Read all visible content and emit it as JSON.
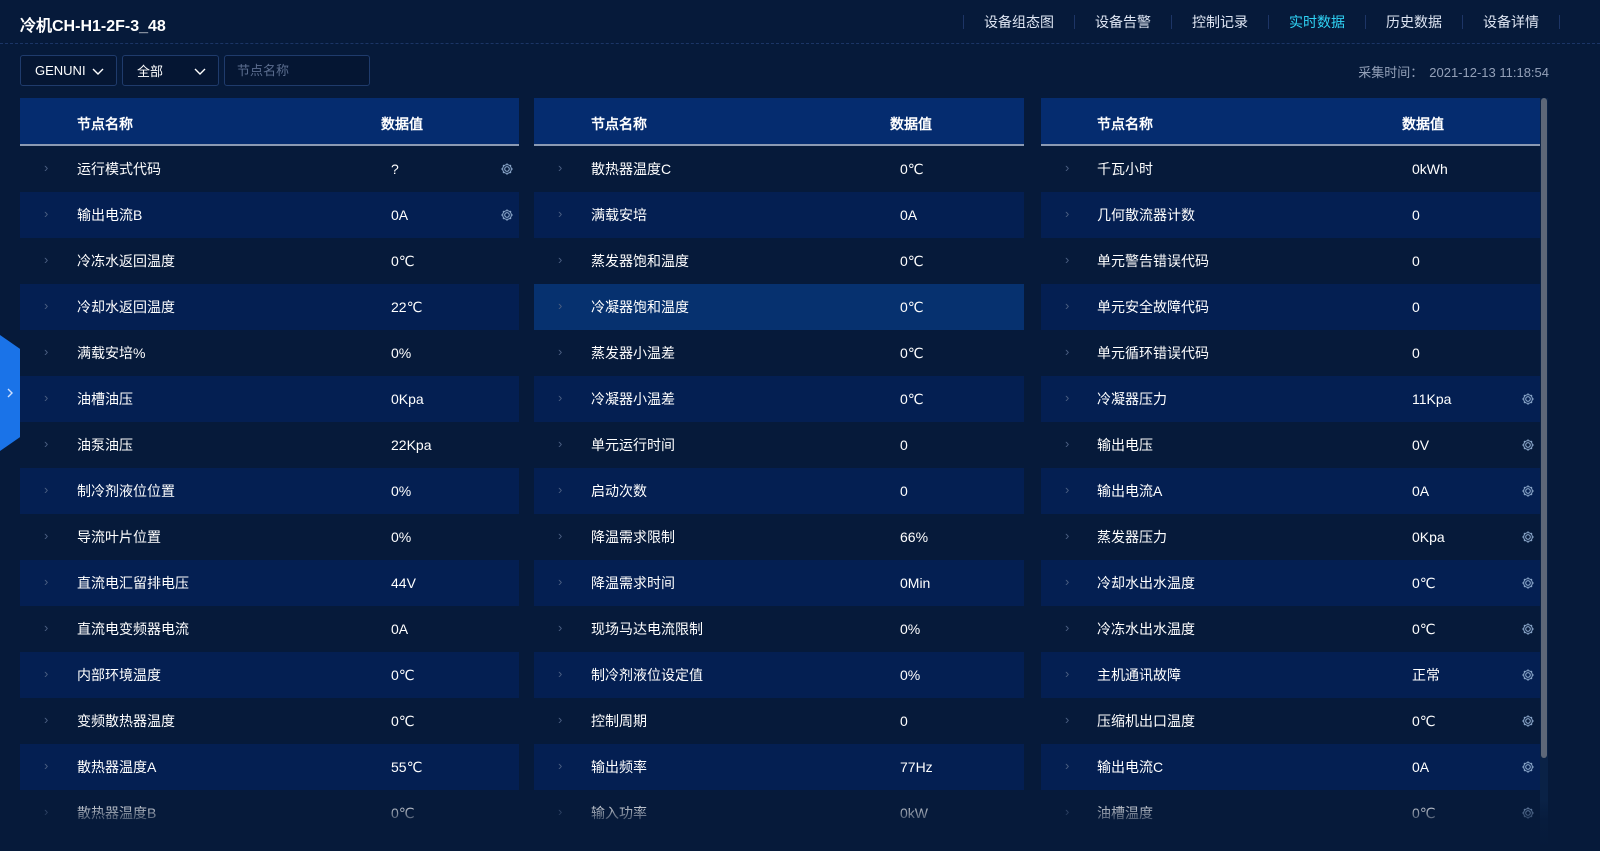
{
  "header": {
    "title": "冷机CH-H1-2F-3_48",
    "nav": [
      "设备组态图",
      "设备告警",
      "控制记录",
      "实时数据",
      "历史数据",
      "设备详情"
    ],
    "active_nav": "实时数据"
  },
  "filters": {
    "select1": "GENUNI",
    "select2": "全部",
    "search_placeholder": "节点名称"
  },
  "collect": {
    "label": "采集时间：",
    "value": "2021-12-13 11:18:54"
  },
  "colors": {
    "accent": "#2fd3f5",
    "background": "#061a3a",
    "header": "#052c6f",
    "side_tab": "#1a73e8"
  },
  "panels": [
    {
      "headers": [
        "节点名称",
        "数据值"
      ],
      "rows": [
        {
          "name": "运行模式代码",
          "value": "?",
          "gear": true
        },
        {
          "name": "输出电流B",
          "value": "0A",
          "gear": true
        },
        {
          "name": "冷冻水返回温度",
          "value": "0℃",
          "gear": false
        },
        {
          "name": "冷却水返回温度",
          "value": "22℃",
          "gear": false
        },
        {
          "name": "满载安培%",
          "value": "0%",
          "gear": false
        },
        {
          "name": "油槽油压",
          "value": "0Kpa",
          "gear": false
        },
        {
          "name": "油泵油压",
          "value": "22Kpa",
          "gear": false
        },
        {
          "name": "制冷剂液位位置",
          "value": "0%",
          "gear": false
        },
        {
          "name": "导流叶片位置",
          "value": "0%",
          "gear": false
        },
        {
          "name": "直流电汇留排电压",
          "value": "44V",
          "gear": false
        },
        {
          "name": "直流电变频器电流",
          "value": "0A",
          "gear": false
        },
        {
          "name": "内部环境温度",
          "value": "0℃",
          "gear": false
        },
        {
          "name": "变频散热器温度",
          "value": "0℃",
          "gear": false
        },
        {
          "name": "散热器温度A",
          "value": "55℃",
          "gear": false
        },
        {
          "name": "散热器温度B",
          "value": "0℃",
          "gear": false
        }
      ]
    },
    {
      "headers": [
        "节点名称",
        "数据值"
      ],
      "rows": [
        {
          "name": "散热器温度C",
          "value": "0℃",
          "gear": false
        },
        {
          "name": "满载安培",
          "value": "0A",
          "gear": false
        },
        {
          "name": "蒸发器饱和温度",
          "value": "0℃",
          "gear": false
        },
        {
          "name": "冷凝器饱和温度",
          "value": "0℃",
          "gear": false,
          "highlight": true
        },
        {
          "name": "蒸发器小温差",
          "value": "0℃",
          "gear": false
        },
        {
          "name": "冷凝器小温差",
          "value": "0℃",
          "gear": false
        },
        {
          "name": "单元运行时间",
          "value": "0",
          "gear": false
        },
        {
          "name": "启动次数",
          "value": "0",
          "gear": false
        },
        {
          "name": "降温需求限制",
          "value": "66%",
          "gear": false
        },
        {
          "name": "降温需求时间",
          "value": "0Min",
          "gear": false
        },
        {
          "name": "现场马达电流限制",
          "value": "0%",
          "gear": false
        },
        {
          "name": "制冷剂液位设定值",
          "value": "0%",
          "gear": false
        },
        {
          "name": "控制周期",
          "value": "0",
          "gear": false
        },
        {
          "name": "输出频率",
          "value": "77Hz",
          "gear": false
        },
        {
          "name": "输入功率",
          "value": "0kW",
          "gear": false
        }
      ]
    },
    {
      "headers": [
        "节点名称",
        "数据值"
      ],
      "rows": [
        {
          "name": "千瓦小时",
          "value": "0kWh",
          "gear": false
        },
        {
          "name": "几何散流器计数",
          "value": "0",
          "gear": false
        },
        {
          "name": "单元警告错误代码",
          "value": "0",
          "gear": false
        },
        {
          "name": "单元安全故障代码",
          "value": "0",
          "gear": false
        },
        {
          "name": "单元循环错误代码",
          "value": "0",
          "gear": false
        },
        {
          "name": "冷凝器压力",
          "value": "11Kpa",
          "gear": true
        },
        {
          "name": "输出电压",
          "value": "0V",
          "gear": true
        },
        {
          "name": "输出电流A",
          "value": "0A",
          "gear": true
        },
        {
          "name": "蒸发器压力",
          "value": "0Kpa",
          "gear": true
        },
        {
          "name": "冷却水出水温度",
          "value": "0℃",
          "gear": true
        },
        {
          "name": "冷冻水出水温度",
          "value": "0℃",
          "gear": true
        },
        {
          "name": "主机通讯故障",
          "value": "正常",
          "gear": true
        },
        {
          "name": "压缩机出口温度",
          "value": "0℃",
          "gear": true
        },
        {
          "name": "输出电流C",
          "value": "0A",
          "gear": true
        },
        {
          "name": "油槽温度",
          "value": "0℃",
          "gear": true
        }
      ]
    }
  ]
}
